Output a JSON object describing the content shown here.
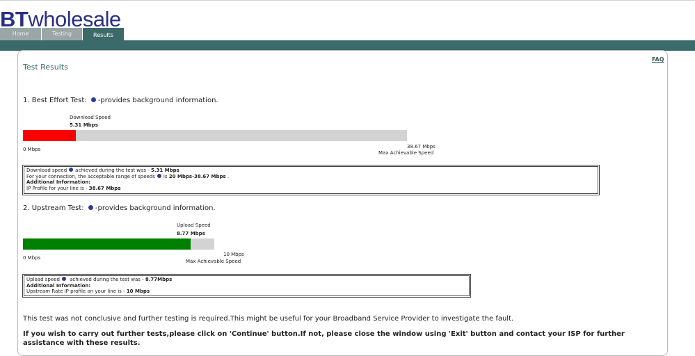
{
  "brand": {
    "bt": "BT",
    "wholesale": "wholesale"
  },
  "tabs": [
    {
      "label": "Home",
      "active": false
    },
    {
      "label": "Testing",
      "active": false
    },
    {
      "label": "Results",
      "active": true
    }
  ],
  "faq_label": "FAQ",
  "page_title": "Test Results",
  "best_effort": {
    "heading": "1. Best Effort Test:",
    "heading_suffix": "-provides background information.",
    "speed_label": "Download Speed",
    "speed_value": "5.31 Mbps",
    "min_label": "0 Mbps",
    "max_value": "38.67 Mbps",
    "max_label": "Max Achievable Speed",
    "fill_fraction": 0.1373,
    "fill_color": "#ff0000",
    "info": {
      "l1_a": "Download speed",
      "l1_b": "achieved during the test was - ",
      "l1_value": "5.31 Mbps",
      "l2_a": "For your connection, the acceptable range of speeds",
      "l2_b": "is ",
      "l2_value": "20 Mbps-38.67 Mbps",
      "l2_end": " .",
      "l3": "Additional Information:",
      "l4_a": "IP Profile for your line is - ",
      "l4_value": "38.67 Mbps"
    }
  },
  "upstream": {
    "heading": "2. Upstream Test:",
    "heading_suffix": "-provides background information.",
    "speed_label": "Upload Speed",
    "speed_value": "8.77 Mbps",
    "min_label": "0 Mbps",
    "max_value": "10 Mbps",
    "max_label": "Max Achievable Speed",
    "fill_fraction": 0.877,
    "fill_color": "#008000",
    "info": {
      "l1_a": "Upload speed",
      "l1_b": " achieved during the test was - ",
      "l1_value": "8.77Mbps",
      "l2": "Additional Information:",
      "l3_a": "Upstream Rate IP profile on your line is - ",
      "l3_value": "10 Mbps"
    }
  },
  "footer_text": "This test was not conclusive and further testing is required.This might be useful for your Broadband Service Provider to investigate the fault.",
  "footer_bold_1": "If you wish to carry out further tests,please click on 'Continue' button.If not, please close the window using 'Exit' button and contact your ISP for further",
  "footer_bold_2": "assistance with these results."
}
